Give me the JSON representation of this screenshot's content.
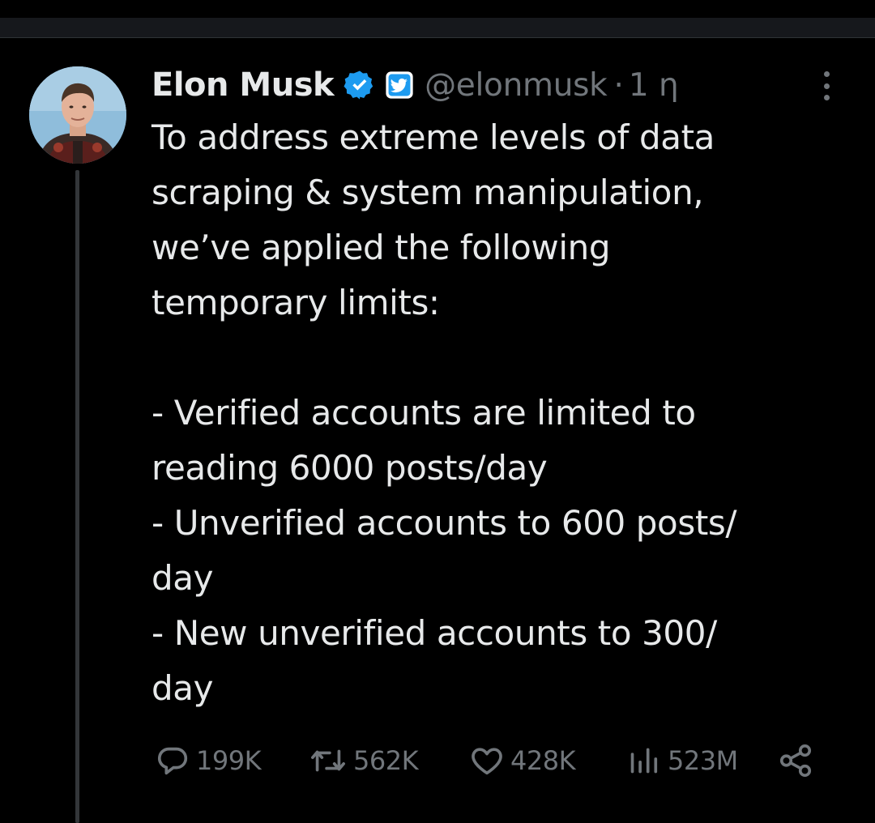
{
  "author": {
    "display_name": "Elon Musk",
    "handle": "@elonmusk",
    "separator": "·",
    "time": "1 η",
    "verified_color": "#1d9bf0",
    "affiliate_color": "#1d9bf0"
  },
  "post": {
    "lines": [
      "To address extreme levels of data",
      "scraping & system manipulation,",
      "we’ve applied the following",
      "temporary limits:",
      "",
      "- Verified accounts are limited to",
      "reading 6000 posts/day",
      "- Unverified accounts to 600 posts/",
      "day",
      "- New unverified accounts to 300/",
      "day"
    ]
  },
  "actions": {
    "replies": "199K",
    "reposts": "562K",
    "likes": "428K",
    "views": "523M"
  },
  "icons": {
    "more": "more-vertical-icon",
    "reply": "reply-icon",
    "repost": "repost-icon",
    "like": "heart-icon",
    "views": "views-chart-icon",
    "share": "share-icon"
  },
  "colors": {
    "background": "#000000",
    "text": "#e7e9ea",
    "secondary": "#71767b",
    "accent": "#1d9bf0"
  }
}
